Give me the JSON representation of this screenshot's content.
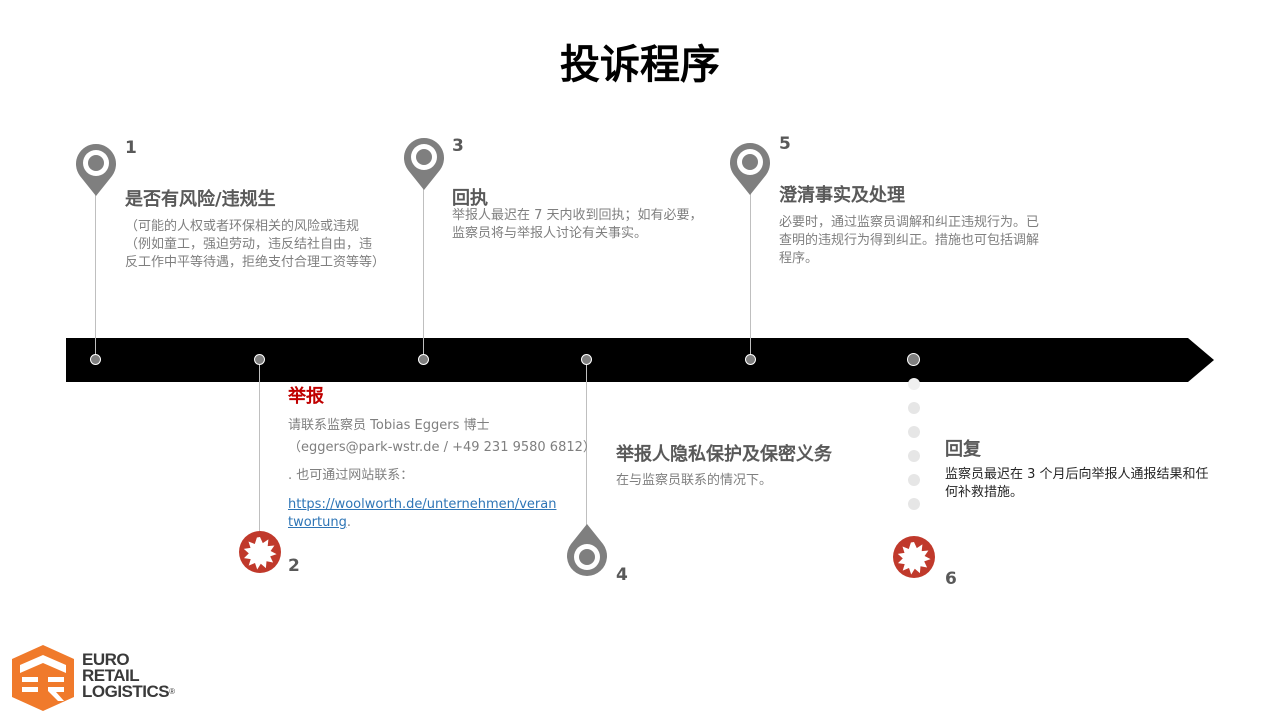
{
  "title": "投诉程序",
  "steps": [
    {
      "num": "1",
      "heading": "是否有风险/违规生",
      "text": "（可能的人权或者环保相关的风险或违规（例如童工，强迫劳动，违反结社自由，违反工作中平等待遇，拒绝支付合理工资等等）"
    },
    {
      "num": "2",
      "heading": "举报",
      "line1": "请联系监察员 Tobias Eggers 博士",
      "line2": "（eggers@park-wstr.de / +49 231 9580 6812）",
      "line3": ". 也可通过网站联系：",
      "link": "https://woolworth.de/unternehmen/verantwortung",
      "link_suffix": "."
    },
    {
      "num": "3",
      "heading": "回执",
      "text": "举报人最迟在 7 天内收到回执；如有必要，监察员将与举报人讨论有关事实。"
    },
    {
      "num": "4",
      "heading": "举报人隐私保护及保密义务",
      "text": "在与监察员联系的情况下。"
    },
    {
      "num": "5",
      "heading": "澄清事实及处理",
      "text": "必要时，通过监察员调解和纠正违规行为。已查明的违规行为得到纠正。措施也可包括调解程序。"
    },
    {
      "num": "6",
      "heading": "回复",
      "text": "监察员最迟在 3 个月后向举报人通报结果和任何补救措施。"
    }
  ],
  "logo": {
    "line1": "EURO",
    "line2": "RETAIL",
    "line3": "LOGISTICS",
    "mark": "®"
  },
  "colors": {
    "arrow": "#000000",
    "pin": "#7f7f7f",
    "badge": "#c0392b",
    "accent": "#c00000",
    "logo": "#f07a2b"
  },
  "icons": [
    "map-pin-icon",
    "seal-badge-icon"
  ]
}
